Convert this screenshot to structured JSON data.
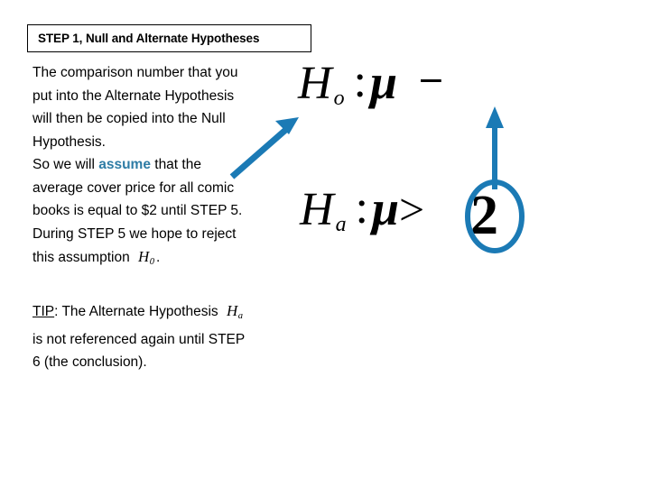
{
  "slide": {
    "title": "STEP 1, Null and Alternate Hypotheses",
    "background_color": "#FFFFFF",
    "accent_color": "#1B7AB5",
    "highlight_color": "#2E7CA5"
  },
  "body": {
    "paragraph_1": "The comparison number that you put into the Alternate Hypothesis will then be copied into the Null Hypothesis.",
    "paragraph_2_before": "So we will ",
    "paragraph_2_highlight": "assume",
    "paragraph_2_after": " that the average cover price for all comic books is equal to $2 until STEP 5.",
    "paragraph_3_before": "During STEP 5 we hope to reject this assumption ",
    "paragraph_3_math_base": "H",
    "paragraph_3_math_sub": "0",
    "paragraph_3_after": ".",
    "tip_label": "TIP",
    "tip_before": ":  The Alternate Hypothesis ",
    "tip_math_base": "H",
    "tip_math_sub": "a",
    "tip_after": " is not referenced again until STEP 6 (the conclusion)."
  },
  "formulas": {
    "null_hypothesis": {
      "base": "H",
      "subscript": "o",
      "colon": ":",
      "parameter": "μ",
      "operator": "=",
      "value": "",
      "full_text": "H o : μ ="
    },
    "alternate_hypothesis": {
      "base": "H",
      "subscript": "a",
      "colon": ":",
      "parameter": "μ",
      "operator": ">",
      "value": "2",
      "full_text": "H a : μ > 2"
    }
  },
  "annotations": {
    "arrow_diagonal_label": "arrow from text to null hypothesis",
    "arrow_vertical_label": "arrow from circled value to null hypothesis",
    "circle_label": "circle around the comparison number 2",
    "color": "#1B7AB5"
  }
}
